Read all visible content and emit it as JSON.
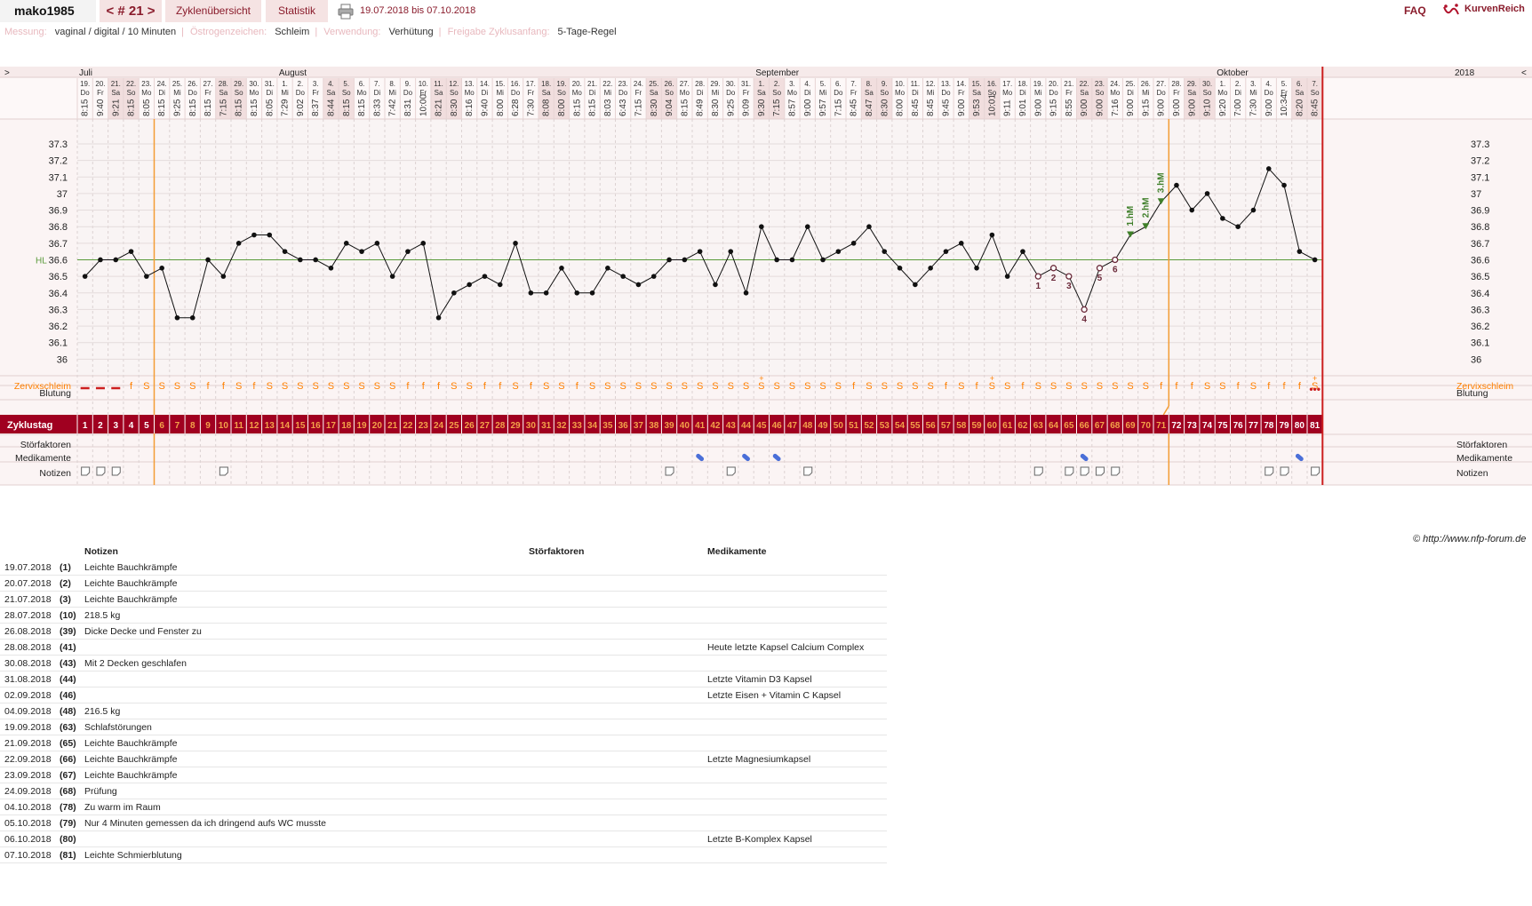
{
  "header": {
    "username": "mako1985",
    "cycle_nav": "< # 21 >",
    "tab_overview": "Zyklenübersicht",
    "tab_stats": "Statistik",
    "date_range": "19.07.2018 bis 07.10.2018",
    "faq": "FAQ",
    "brand": "KurvenReich"
  },
  "info": {
    "measurement_label": "Messung:",
    "measurement_value": "vaginal / digital / 10 Minuten",
    "estrogen_label": "Östrogenzeichen:",
    "estrogen_value": "Schleim",
    "usage_label": "Verwendung:",
    "usage_value": "Verhütung",
    "release_label": "Freigabe Zyklusanfang:",
    "release_value": "5-Tage-Regel"
  },
  "chart_data": {
    "type": "line",
    "year": "2018",
    "nav_left": ">",
    "nav_right": "<",
    "months": [
      {
        "name": "Juli",
        "day": 1
      },
      {
        "name": "August",
        "day": 14
      },
      {
        "name": "September",
        "day": 45
      },
      {
        "name": "Oktober",
        "day": 75
      }
    ],
    "days": [
      {
        "d": "19.",
        "w": "Do",
        "t": "8:15",
        "temp": 36.5,
        "cm": "",
        "bl": 1,
        "no": 1,
        "me": 0
      },
      {
        "d": "20.",
        "w": "Fr",
        "t": "9:40",
        "temp": 36.6,
        "cm": "",
        "bl": 1,
        "no": 1,
        "me": 0
      },
      {
        "d": "21.",
        "w": "Sa",
        "t": "9:21",
        "temp": 36.6,
        "cm": "",
        "bl": 1,
        "no": 1,
        "me": 0
      },
      {
        "d": "22.",
        "w": "So",
        "t": "8:15",
        "temp": 36.65,
        "cm": "f",
        "bl": 0,
        "no": 0,
        "me": 0
      },
      {
        "d": "23.",
        "w": "Mo",
        "t": "8:05",
        "temp": 36.5,
        "cm": "S",
        "bl": 0,
        "no": 0,
        "me": 0
      },
      {
        "d": "24.",
        "w": "Di",
        "t": "8:15",
        "temp": 36.55,
        "cm": "S",
        "bl": 0,
        "no": 0,
        "me": 0
      },
      {
        "d": "25.",
        "w": "Mi",
        "t": "9:25",
        "temp": 36.25,
        "cm": "S",
        "bl": 0,
        "no": 0,
        "me": 0
      },
      {
        "d": "26.",
        "w": "Do",
        "t": "8:15",
        "temp": 36.25,
        "cm": "S",
        "bl": 0,
        "no": 0,
        "me": 0
      },
      {
        "d": "27.",
        "w": "Fr",
        "t": "8:15",
        "temp": 36.6,
        "cm": "f",
        "bl": 0,
        "no": 0,
        "me": 0
      },
      {
        "d": "28.",
        "w": "Sa",
        "t": "7:15",
        "temp": 36.5,
        "cm": "f",
        "bl": 0,
        "no": 1,
        "me": 0
      },
      {
        "d": "29.",
        "w": "So",
        "t": "8:15",
        "temp": 36.7,
        "cm": "S",
        "bl": 0,
        "no": 0,
        "me": 0
      },
      {
        "d": "30.",
        "w": "Mo",
        "t": "8:15",
        "temp": 36.75,
        "cm": "f",
        "bl": 0,
        "no": 0,
        "me": 0
      },
      {
        "d": "31.",
        "w": "Di",
        "t": "8:05",
        "temp": 36.75,
        "cm": "S",
        "bl": 0,
        "no": 0,
        "me": 0
      },
      {
        "d": "1.",
        "w": "Mi",
        "t": "7:29",
        "temp": 36.65,
        "cm": "S",
        "bl": 0,
        "no": 0,
        "me": 0
      },
      {
        "d": "2.",
        "w": "Do",
        "t": "9:02",
        "temp": 36.6,
        "cm": "S",
        "bl": 0,
        "no": 0,
        "me": 0
      },
      {
        "d": "3.",
        "w": "Fr",
        "t": "8:37",
        "temp": 36.6,
        "cm": "S",
        "bl": 0,
        "no": 0,
        "me": 0
      },
      {
        "d": "4.",
        "w": "Sa",
        "t": "8:44",
        "temp": 36.55,
        "cm": "S",
        "bl": 0,
        "no": 0,
        "me": 0
      },
      {
        "d": "5.",
        "w": "So",
        "t": "8:15",
        "temp": 36.7,
        "cm": "S",
        "bl": 0,
        "no": 0,
        "me": 0
      },
      {
        "d": "6.",
        "w": "Mo",
        "t": "8:15",
        "temp": 36.65,
        "cm": "S",
        "bl": 0,
        "no": 0,
        "me": 0
      },
      {
        "d": "7.",
        "w": "Di",
        "t": "8:33",
        "temp": 36.7,
        "cm": "S",
        "bl": 0,
        "no": 0,
        "me": 0
      },
      {
        "d": "8.",
        "w": "Mi",
        "t": "7:42",
        "temp": 36.5,
        "cm": "S",
        "bl": 0,
        "no": 0,
        "me": 0
      },
      {
        "d": "9.",
        "w": "Do",
        "t": "8:31",
        "temp": 36.65,
        "cm": "f",
        "bl": 0,
        "no": 0,
        "me": 0
      },
      {
        "d": "10.",
        "w": "Fr",
        "t": "10:00",
        "temp": 36.7,
        "cm": "f",
        "bl": 0,
        "no": 0,
        "me": 0
      },
      {
        "d": "11.",
        "w": "Sa",
        "t": "8:21",
        "temp": 36.25,
        "cm": "f",
        "bl": 0,
        "no": 0,
        "me": 0
      },
      {
        "d": "12.",
        "w": "So",
        "t": "8:30",
        "temp": 36.4,
        "cm": "S",
        "bl": 0,
        "no": 0,
        "me": 0
      },
      {
        "d": "13.",
        "w": "Mo",
        "t": "8:16",
        "temp": 36.45,
        "cm": "S",
        "bl": 0,
        "no": 0,
        "me": 0
      },
      {
        "d": "14.",
        "w": "Di",
        "t": "9:40",
        "temp": 36.5,
        "cm": "f",
        "bl": 0,
        "no": 0,
        "me": 0
      },
      {
        "d": "15.",
        "w": "Mi",
        "t": "8:00",
        "temp": 36.45,
        "cm": "f",
        "bl": 0,
        "no": 0,
        "me": 0
      },
      {
        "d": "16.",
        "w": "Do",
        "t": "6:28",
        "temp": 36.7,
        "cm": "S",
        "bl": 0,
        "no": 0,
        "me": 0
      },
      {
        "d": "17.",
        "w": "Fr",
        "t": "7:30",
        "temp": 36.4,
        "cm": "f",
        "bl": 0,
        "no": 0,
        "me": 0
      },
      {
        "d": "18.",
        "w": "Sa",
        "t": "8:08",
        "temp": 36.4,
        "cm": "S",
        "bl": 0,
        "no": 0,
        "me": 0
      },
      {
        "d": "19.",
        "w": "So",
        "t": "8:00",
        "temp": 36.55,
        "cm": "S",
        "bl": 0,
        "no": 0,
        "me": 0
      },
      {
        "d": "20.",
        "w": "Mo",
        "t": "8:15",
        "temp": 36.4,
        "cm": "f",
        "bl": 0,
        "no": 0,
        "me": 0
      },
      {
        "d": "21.",
        "w": "Di",
        "t": "8:15",
        "temp": 36.4,
        "cm": "S",
        "bl": 0,
        "no": 0,
        "me": 0
      },
      {
        "d": "22.",
        "w": "Mi",
        "t": "8:03",
        "temp": 36.55,
        "cm": "S",
        "bl": 0,
        "no": 0,
        "me": 0
      },
      {
        "d": "23.",
        "w": "Do",
        "t": "6:43",
        "temp": 36.5,
        "cm": "S",
        "bl": 0,
        "no": 0,
        "me": 0
      },
      {
        "d": "24.",
        "w": "Fr",
        "t": "7:15",
        "temp": 36.45,
        "cm": "S",
        "bl": 0,
        "no": 0,
        "me": 0
      },
      {
        "d": "25.",
        "w": "Sa",
        "t": "8:30",
        "temp": 36.5,
        "cm": "S",
        "bl": 0,
        "no": 0,
        "me": 0
      },
      {
        "d": "26.",
        "w": "So",
        "t": "9:04",
        "temp": 36.6,
        "cm": "S",
        "bl": 0,
        "no": 1,
        "me": 0
      },
      {
        "d": "27.",
        "w": "Mo",
        "t": "8:15",
        "temp": 36.6,
        "cm": "S",
        "bl": 0,
        "no": 0,
        "me": 0
      },
      {
        "d": "28.",
        "w": "Di",
        "t": "8:49",
        "temp": 36.65,
        "cm": "S",
        "bl": 0,
        "no": 0,
        "me": 1
      },
      {
        "d": "29.",
        "w": "Mi",
        "t": "8:30",
        "temp": 36.45,
        "cm": "S",
        "bl": 0,
        "no": 0,
        "me": 0
      },
      {
        "d": "30.",
        "w": "Do",
        "t": "9:25",
        "temp": 36.65,
        "cm": "S",
        "bl": 0,
        "no": 1,
        "me": 0
      },
      {
        "d": "31.",
        "w": "Fr",
        "t": "9:09",
        "temp": 36.4,
        "cm": "S",
        "bl": 0,
        "no": 0,
        "me": 1
      },
      {
        "d": "1.",
        "w": "Sa",
        "t": "9:30",
        "temp": 36.8,
        "cm": "S+",
        "bl": 0,
        "no": 0,
        "me": 0
      },
      {
        "d": "2.",
        "w": "So",
        "t": "7:15",
        "temp": 36.6,
        "cm": "S",
        "bl": 0,
        "no": 0,
        "me": 1
      },
      {
        "d": "3.",
        "w": "Mo",
        "t": "8:57",
        "temp": 36.6,
        "cm": "S",
        "bl": 0,
        "no": 0,
        "me": 0
      },
      {
        "d": "4.",
        "w": "Di",
        "t": "9:00",
        "temp": 36.8,
        "cm": "S",
        "bl": 0,
        "no": 1,
        "me": 0
      },
      {
        "d": "5.",
        "w": "Mi",
        "t": "9:57",
        "temp": 36.6,
        "cm": "S",
        "bl": 0,
        "no": 0,
        "me": 0
      },
      {
        "d": "6.",
        "w": "Do",
        "t": "7:15",
        "temp": 36.65,
        "cm": "S",
        "bl": 0,
        "no": 0,
        "me": 0
      },
      {
        "d": "7.",
        "w": "Fr",
        "t": "8:45",
        "temp": 36.7,
        "cm": "f",
        "bl": 0,
        "no": 0,
        "me": 0
      },
      {
        "d": "8.",
        "w": "Sa",
        "t": "8:47",
        "temp": 36.8,
        "cm": "S",
        "bl": 0,
        "no": 0,
        "me": 0
      },
      {
        "d": "9.",
        "w": "So",
        "t": "8:30",
        "temp": 36.65,
        "cm": "S",
        "bl": 0,
        "no": 0,
        "me": 0
      },
      {
        "d": "10.",
        "w": "Mo",
        "t": "8:00",
        "temp": 36.55,
        "cm": "S",
        "bl": 0,
        "no": 0,
        "me": 0
      },
      {
        "d": "11.",
        "w": "Di",
        "t": "8:45",
        "temp": 36.45,
        "cm": "S",
        "bl": 0,
        "no": 0,
        "me": 0
      },
      {
        "d": "12.",
        "w": "Mi",
        "t": "8:45",
        "temp": 36.55,
        "cm": "S",
        "bl": 0,
        "no": 0,
        "me": 0
      },
      {
        "d": "13.",
        "w": "Do",
        "t": "9:45",
        "temp": 36.65,
        "cm": "f",
        "bl": 0,
        "no": 0,
        "me": 0
      },
      {
        "d": "14.",
        "w": "Fr",
        "t": "9:00",
        "temp": 36.7,
        "cm": "S",
        "bl": 0,
        "no": 0,
        "me": 0
      },
      {
        "d": "15.",
        "w": "Sa",
        "t": "9:53",
        "temp": 36.55,
        "cm": "f",
        "bl": 0,
        "no": 0,
        "me": 0
      },
      {
        "d": "16.",
        "w": "So",
        "t": "10:01",
        "temp": 36.75,
        "cm": "S+",
        "bl": 0,
        "no": 0,
        "me": 0
      },
      {
        "d": "17.",
        "w": "Mo",
        "t": "9:11",
        "temp": 36.5,
        "cm": "S",
        "bl": 0,
        "no": 0,
        "me": 0
      },
      {
        "d": "18.",
        "w": "Di",
        "t": "9:01",
        "temp": 36.65,
        "cm": "f",
        "bl": 0,
        "no": 0,
        "me": 0
      },
      {
        "d": "19.",
        "w": "Mi",
        "t": "9:00",
        "temp": 36.5,
        "cm": "S",
        "bl": 0,
        "no": 1,
        "me": 0,
        "m": "1"
      },
      {
        "d": "20.",
        "w": "Do",
        "t": "9:15",
        "temp": 36.55,
        "cm": "S",
        "bl": 0,
        "no": 0,
        "me": 0,
        "m": "2"
      },
      {
        "d": "21.",
        "w": "Fr",
        "t": "8:55",
        "temp": 36.5,
        "cm": "S",
        "bl": 0,
        "no": 1,
        "me": 0,
        "m": "3"
      },
      {
        "d": "22.",
        "w": "Sa",
        "t": "9:00",
        "temp": 36.3,
        "cm": "S",
        "bl": 0,
        "no": 1,
        "me": 1,
        "m": "4"
      },
      {
        "d": "23.",
        "w": "So",
        "t": "9:00",
        "temp": 36.55,
        "cm": "S",
        "bl": 0,
        "no": 1,
        "me": 0,
        "m": "5"
      },
      {
        "d": "24.",
        "w": "Mo",
        "t": "7:16",
        "temp": 36.6,
        "cm": "S",
        "bl": 0,
        "no": 1,
        "me": 0,
        "m": "6"
      },
      {
        "d": "25.",
        "w": "Di",
        "t": "9:00",
        "temp": 36.75,
        "cm": "S",
        "bl": 0,
        "no": 0,
        "me": 0,
        "h": "1.hM"
      },
      {
        "d": "26.",
        "w": "Mi",
        "t": "9:15",
        "temp": 36.8,
        "cm": "S",
        "bl": 0,
        "no": 0,
        "me": 0,
        "h": "2.hM"
      },
      {
        "d": "27.",
        "w": "Do",
        "t": "9:00",
        "temp": 36.95,
        "cm": "f",
        "bl": 0,
        "no": 0,
        "me": 0,
        "h": "3.hM"
      },
      {
        "d": "28.",
        "w": "Fr",
        "t": "9:00",
        "temp": 37.05,
        "cm": "f",
        "bl": 0,
        "no": 0,
        "me": 0
      },
      {
        "d": "29.",
        "w": "Sa",
        "t": "9:00",
        "temp": 36.9,
        "cm": "f",
        "bl": 0,
        "no": 0,
        "me": 0
      },
      {
        "d": "30.",
        "w": "So",
        "t": "9:10",
        "temp": 37.0,
        "cm": "S",
        "bl": 0,
        "no": 0,
        "me": 0
      },
      {
        "d": "1.",
        "w": "Mo",
        "t": "9:20",
        "temp": 36.85,
        "cm": "S",
        "bl": 0,
        "no": 0,
        "me": 0
      },
      {
        "d": "2.",
        "w": "Di",
        "t": "7:00",
        "temp": 36.8,
        "cm": "f",
        "bl": 0,
        "no": 0,
        "me": 0
      },
      {
        "d": "3.",
        "w": "Mi",
        "t": "7:30",
        "temp": 36.9,
        "cm": "S",
        "bl": 0,
        "no": 0,
        "me": 0
      },
      {
        "d": "4.",
        "w": "Do",
        "t": "9:00",
        "temp": 37.15,
        "cm": "f",
        "bl": 0,
        "no": 1,
        "me": 0
      },
      {
        "d": "5.",
        "w": "Fr",
        "t": "10:34",
        "temp": 37.05,
        "cm": "f",
        "bl": 0,
        "no": 1,
        "me": 0
      },
      {
        "d": "6.",
        "w": "Sa",
        "t": "8:20",
        "temp": 36.65,
        "cm": "f",
        "bl": 0,
        "no": 0,
        "me": 1
      },
      {
        "d": "7.",
        "w": "So",
        "t": "8:45",
        "temp": 36.6,
        "cm": "S+",
        "bl": 2,
        "no": 1,
        "me": 0
      }
    ],
    "y_ticks": [
      "37.3",
      "37.2",
      "37.1",
      "37",
      "36.9",
      "36.8",
      "36.7",
      "36.6",
      "36.5",
      "36.4",
      "36.3",
      "36.2",
      "36.1",
      "36"
    ],
    "y_tick_values": [
      37.3,
      37.2,
      37.1,
      37,
      36.9,
      36.8,
      36.7,
      36.6,
      36.5,
      36.4,
      36.3,
      36.2,
      36.1,
      36.0
    ],
    "y_range": [
      35.9,
      37.45
    ],
    "coverline_label": "HL",
    "coverline_temp": 36.6,
    "phase_start_day": 6,
    "phase_end_day": 72,
    "row_labels": {
      "cervix": "Zervixschleim",
      "bleeding": "Blutung",
      "cycle_day": "Zyklustag",
      "disturbance": "Störfaktoren",
      "medication": "Medikamente",
      "notes": "Notizen"
    },
    "colors": {
      "temp_line": "#111111",
      "coverline": "#5a9a3a",
      "phase_line": "#f39c34",
      "cycle_end": "#cc1f1f",
      "cycle_bar": "#a00020",
      "cervix_text": "#ff8000",
      "bleeding": "#cc1f1f",
      "marker": "#6b2a3a",
      "hm_marker": "#3f7f2a",
      "medication": "#4a6fd8"
    }
  },
  "copyright": "© http://www.nfp-forum.de",
  "notes_table": {
    "headers": [
      "",
      "",
      "Notizen",
      "Störfaktoren",
      "Medikamente"
    ],
    "rows": [
      [
        "19.07.2018",
        "(1)",
        "Leichte Bauchkrämpfe",
        "",
        ""
      ],
      [
        "20.07.2018",
        "(2)",
        "Leichte Bauchkrämpfe",
        "",
        ""
      ],
      [
        "21.07.2018",
        "(3)",
        "Leichte Bauchkrämpfe",
        "",
        ""
      ],
      [
        "28.07.2018",
        "(10)",
        "218.5 kg",
        "",
        ""
      ],
      [
        "26.08.2018",
        "(39)",
        "Dicke Decke und Fenster zu",
        "",
        ""
      ],
      [
        "28.08.2018",
        "(41)",
        "",
        "",
        "Heute letzte Kapsel Calcium Complex"
      ],
      [
        "30.08.2018",
        "(43)",
        "Mit 2 Decken geschlafen",
        "",
        ""
      ],
      [
        "31.08.2018",
        "(44)",
        "",
        "",
        "Letzte Vitamin D3 Kapsel"
      ],
      [
        "02.09.2018",
        "(46)",
        "",
        "",
        "Letzte Eisen + Vitamin C Kapsel"
      ],
      [
        "04.09.2018",
        "(48)",
        "216.5 kg",
        "",
        ""
      ],
      [
        "19.09.2018",
        "(63)",
        "Schlafstörungen",
        "",
        ""
      ],
      [
        "21.09.2018",
        "(65)",
        "Leichte Bauchkrämpfe",
        "",
        ""
      ],
      [
        "22.09.2018",
        "(66)",
        "Leichte Bauchkrämpfe",
        "",
        "Letzte Magnesiumkapsel"
      ],
      [
        "23.09.2018",
        "(67)",
        "Leichte Bauchkrämpfe",
        "",
        ""
      ],
      [
        "24.09.2018",
        "(68)",
        "Prüfung",
        "",
        ""
      ],
      [
        "04.10.2018",
        "(78)",
        "Zu warm im Raum",
        "",
        ""
      ],
      [
        "05.10.2018",
        "(79)",
        "Nur 4 Minuten gemessen da ich dringend aufs WC musste",
        "",
        ""
      ],
      [
        "06.10.2018",
        "(80)",
        "",
        "",
        "Letzte B-Komplex Kapsel"
      ],
      [
        "07.10.2018",
        "(81)",
        "Leichte Schmierblutung",
        "",
        ""
      ]
    ]
  }
}
